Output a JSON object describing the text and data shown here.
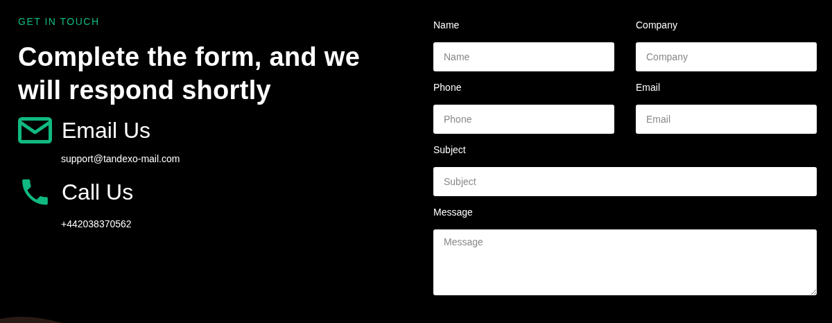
{
  "eyebrow": "GET IN TOUCH",
  "heading": "Complete the form, and we will respond shortly",
  "contacts": [
    {
      "kind": "email",
      "title": "Email Us",
      "detail": "support@tandexo-mail.com"
    },
    {
      "kind": "phone",
      "title": "Call Us",
      "detail": "+442038370562"
    }
  ],
  "form": {
    "fields": [
      {
        "kind": "input",
        "label": "Name",
        "placeholder": "Name",
        "wide": false
      },
      {
        "kind": "input",
        "label": "Company",
        "placeholder": "Company",
        "wide": false
      },
      {
        "kind": "input",
        "label": "Phone",
        "placeholder": "Phone",
        "wide": false
      },
      {
        "kind": "input",
        "label": "Email",
        "placeholder": "Email",
        "wide": false
      },
      {
        "kind": "input",
        "label": "Subject",
        "placeholder": "Subject",
        "wide": true
      },
      {
        "kind": "textarea",
        "label": "Message",
        "placeholder": "Message",
        "wide": true
      }
    ]
  }
}
